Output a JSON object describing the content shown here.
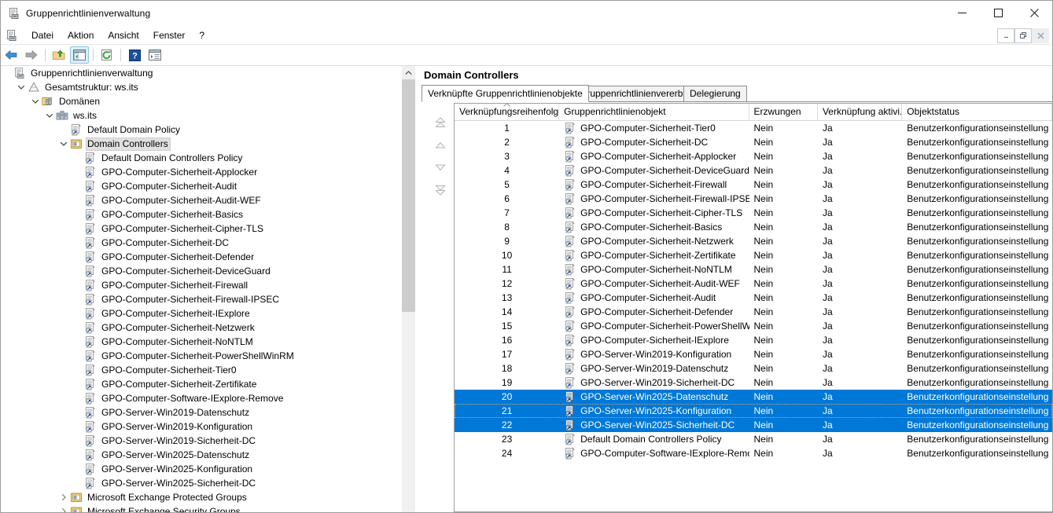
{
  "window": {
    "title": "Gruppenrichtlinienverwaltung",
    "icon": "gpmc-icon",
    "controls": {
      "minimize": "minimize-icon",
      "maximize": "maximize-icon",
      "close": "close-icon"
    }
  },
  "menubar": {
    "doc_icon": "gpmc-document-icon",
    "items": [
      "Datei",
      "Aktion",
      "Ansicht",
      "Fenster",
      "?"
    ],
    "mdi_controls": {
      "minimize": "mdi-minimize-icon",
      "restore": "mdi-restore-icon",
      "close": "mdi-close-icon"
    }
  },
  "toolbar": {
    "buttons": [
      {
        "name": "back-icon",
        "label": "Zurück"
      },
      {
        "name": "forward-icon",
        "label": "Vorwärts"
      },
      {
        "name": "up-folder-icon",
        "label": "Eine Ebene höher"
      },
      {
        "name": "show-hide-tree-icon",
        "label": "Konsolenstruktur anzeigen/ausblenden"
      },
      {
        "name": "refresh-icon",
        "label": "Aktualisieren"
      },
      {
        "name": "help-icon",
        "label": "Hilfe"
      },
      {
        "name": "export-list-icon",
        "label": "Liste exportieren"
      }
    ]
  },
  "tree": {
    "scrollbar": {
      "up_arrow": "chevron-up-icon"
    },
    "items": [
      {
        "label": "Gruppenrichtlinienverwaltung",
        "indent": 0,
        "twisty": "",
        "icon": "gpmc-root-icon",
        "selected": false
      },
      {
        "label": "Gesamtstruktur: ws.its",
        "indent": 1,
        "twisty": "expanded",
        "icon": "forest-icon",
        "selected": false
      },
      {
        "label": "Domänen",
        "indent": 2,
        "twisty": "expanded",
        "icon": "domains-icon",
        "selected": false
      },
      {
        "label": "ws.its",
        "indent": 3,
        "twisty": "expanded",
        "icon": "domain-icon",
        "selected": false
      },
      {
        "label": "Default Domain Policy",
        "indent": 4,
        "twisty": "",
        "icon": "gpo-icon",
        "selected": false
      },
      {
        "label": "Domain Controllers",
        "indent": 4,
        "twisty": "expanded",
        "icon": "ou-icon",
        "selected": true
      },
      {
        "label": "Default Domain Controllers Policy",
        "indent": 5,
        "twisty": "",
        "icon": "gpo-link-icon",
        "selected": false
      },
      {
        "label": "GPO-Computer-Sicherheit-Applocker",
        "indent": 5,
        "twisty": "",
        "icon": "gpo-link-icon",
        "selected": false
      },
      {
        "label": "GPO-Computer-Sicherheit-Audit",
        "indent": 5,
        "twisty": "",
        "icon": "gpo-link-icon",
        "selected": false
      },
      {
        "label": "GPO-Computer-Sicherheit-Audit-WEF",
        "indent": 5,
        "twisty": "",
        "icon": "gpo-link-icon",
        "selected": false
      },
      {
        "label": "GPO-Computer-Sicherheit-Basics",
        "indent": 5,
        "twisty": "",
        "icon": "gpo-link-icon",
        "selected": false
      },
      {
        "label": "GPO-Computer-Sicherheit-Cipher-TLS",
        "indent": 5,
        "twisty": "",
        "icon": "gpo-link-icon",
        "selected": false
      },
      {
        "label": "GPO-Computer-Sicherheit-DC",
        "indent": 5,
        "twisty": "",
        "icon": "gpo-link-icon",
        "selected": false
      },
      {
        "label": "GPO-Computer-Sicherheit-Defender",
        "indent": 5,
        "twisty": "",
        "icon": "gpo-link-icon",
        "selected": false
      },
      {
        "label": "GPO-Computer-Sicherheit-DeviceGuard",
        "indent": 5,
        "twisty": "",
        "icon": "gpo-link-icon",
        "selected": false
      },
      {
        "label": "GPO-Computer-Sicherheit-Firewall",
        "indent": 5,
        "twisty": "",
        "icon": "gpo-link-icon",
        "selected": false
      },
      {
        "label": "GPO-Computer-Sicherheit-Firewall-IPSEC",
        "indent": 5,
        "twisty": "",
        "icon": "gpo-link-icon",
        "selected": false
      },
      {
        "label": "GPO-Computer-Sicherheit-IExplore",
        "indent": 5,
        "twisty": "",
        "icon": "gpo-link-icon",
        "selected": false
      },
      {
        "label": "GPO-Computer-Sicherheit-Netzwerk",
        "indent": 5,
        "twisty": "",
        "icon": "gpo-link-icon",
        "selected": false
      },
      {
        "label": "GPO-Computer-Sicherheit-NoNTLM",
        "indent": 5,
        "twisty": "",
        "icon": "gpo-link-icon",
        "selected": false
      },
      {
        "label": "GPO-Computer-Sicherheit-PowerShellWinRM",
        "indent": 5,
        "twisty": "",
        "icon": "gpo-link-icon",
        "selected": false
      },
      {
        "label": "GPO-Computer-Sicherheit-Tier0",
        "indent": 5,
        "twisty": "",
        "icon": "gpo-link-icon",
        "selected": false
      },
      {
        "label": "GPO-Computer-Sicherheit-Zertifikate",
        "indent": 5,
        "twisty": "",
        "icon": "gpo-link-icon",
        "selected": false
      },
      {
        "label": "GPO-Computer-Software-IExplore-Remove",
        "indent": 5,
        "twisty": "",
        "icon": "gpo-link-icon",
        "selected": false
      },
      {
        "label": "GPO-Server-Win2019-Datenschutz",
        "indent": 5,
        "twisty": "",
        "icon": "gpo-link-icon",
        "selected": false
      },
      {
        "label": "GPO-Server-Win2019-Konfiguration",
        "indent": 5,
        "twisty": "",
        "icon": "gpo-link-icon",
        "selected": false
      },
      {
        "label": "GPO-Server-Win2019-Sicherheit-DC",
        "indent": 5,
        "twisty": "",
        "icon": "gpo-link-icon",
        "selected": false
      },
      {
        "label": "GPO-Server-Win2025-Datenschutz",
        "indent": 5,
        "twisty": "",
        "icon": "gpo-link-icon",
        "selected": false
      },
      {
        "label": "GPO-Server-Win2025-Konfiguration",
        "indent": 5,
        "twisty": "",
        "icon": "gpo-link-icon",
        "selected": false
      },
      {
        "label": "GPO-Server-Win2025-Sicherheit-DC",
        "indent": 5,
        "twisty": "",
        "icon": "gpo-link-icon",
        "selected": false
      },
      {
        "label": "Microsoft Exchange Protected Groups",
        "indent": 4,
        "twisty": "collapsed",
        "icon": "ou-icon",
        "selected": false
      },
      {
        "label": "Microsoft Exchange Security Groups",
        "indent": 4,
        "twisty": "collapsed",
        "icon": "ou-icon",
        "selected": false
      }
    ]
  },
  "detail": {
    "title": "Domain Controllers",
    "tabs": [
      {
        "label": "Verknüpfte Gruppenrichtlinienobjekte",
        "active": true
      },
      {
        "label": "Gruppenrichtlinienvererbung",
        "active": false
      },
      {
        "label": "Delegierung",
        "active": false
      }
    ],
    "order_buttons": [
      {
        "name": "move-to-top-button",
        "icon": "double-up-arrow-icon"
      },
      {
        "name": "move-up-button",
        "icon": "up-arrow-icon"
      },
      {
        "name": "move-down-button",
        "icon": "down-arrow-icon"
      },
      {
        "name": "move-to-bottom-button",
        "icon": "double-down-arrow-icon"
      }
    ],
    "list": {
      "sort_column": 0,
      "sort_direction": "ascending",
      "columns": [
        "Verknüpfungsreihenfolge",
        "Gruppenrichtlinienobjekt",
        "Erzwungen",
        "Verknüpfung aktivi...",
        "Objektstatus"
      ],
      "rows": [
        {
          "order": "1",
          "gpo": "GPO-Computer-Sicherheit-Tier0",
          "enforced": "Nein",
          "link_enabled": "Ja",
          "status": "Benutzerkonfigurationseinstellung",
          "selected": false,
          "focused": false
        },
        {
          "order": "2",
          "gpo": "GPO-Computer-Sicherheit-DC",
          "enforced": "Nein",
          "link_enabled": "Ja",
          "status": "Benutzerkonfigurationseinstellung",
          "selected": false,
          "focused": false
        },
        {
          "order": "3",
          "gpo": "GPO-Computer-Sicherheit-Applocker",
          "enforced": "Nein",
          "link_enabled": "Ja",
          "status": "Benutzerkonfigurationseinstellung",
          "selected": false,
          "focused": false
        },
        {
          "order": "4",
          "gpo": "GPO-Computer-Sicherheit-DeviceGuard",
          "enforced": "Nein",
          "link_enabled": "Ja",
          "status": "Benutzerkonfigurationseinstellung",
          "selected": false,
          "focused": false
        },
        {
          "order": "5",
          "gpo": "GPO-Computer-Sicherheit-Firewall",
          "enforced": "Nein",
          "link_enabled": "Ja",
          "status": "Benutzerkonfigurationseinstellung",
          "selected": false,
          "focused": false
        },
        {
          "order": "6",
          "gpo": "GPO-Computer-Sicherheit-Firewall-IPSEC",
          "enforced": "Nein",
          "link_enabled": "Ja",
          "status": "Benutzerkonfigurationseinstellung",
          "selected": false,
          "focused": false
        },
        {
          "order": "7",
          "gpo": "GPO-Computer-Sicherheit-Cipher-TLS",
          "enforced": "Nein",
          "link_enabled": "Ja",
          "status": "Benutzerkonfigurationseinstellung",
          "selected": false,
          "focused": false
        },
        {
          "order": "8",
          "gpo": "GPO-Computer-Sicherheit-Basics",
          "enforced": "Nein",
          "link_enabled": "Ja",
          "status": "Benutzerkonfigurationseinstellung",
          "selected": false,
          "focused": false
        },
        {
          "order": "9",
          "gpo": "GPO-Computer-Sicherheit-Netzwerk",
          "enforced": "Nein",
          "link_enabled": "Ja",
          "status": "Benutzerkonfigurationseinstellung",
          "selected": false,
          "focused": false
        },
        {
          "order": "10",
          "gpo": "GPO-Computer-Sicherheit-Zertifikate",
          "enforced": "Nein",
          "link_enabled": "Ja",
          "status": "Benutzerkonfigurationseinstellung",
          "selected": false,
          "focused": false
        },
        {
          "order": "11",
          "gpo": "GPO-Computer-Sicherheit-NoNTLM",
          "enforced": "Nein",
          "link_enabled": "Ja",
          "status": "Benutzerkonfigurationseinstellung",
          "selected": false,
          "focused": false
        },
        {
          "order": "12",
          "gpo": "GPO-Computer-Sicherheit-Audit-WEF",
          "enforced": "Nein",
          "link_enabled": "Ja",
          "status": "Benutzerkonfigurationseinstellung",
          "selected": false,
          "focused": false
        },
        {
          "order": "13",
          "gpo": "GPO-Computer-Sicherheit-Audit",
          "enforced": "Nein",
          "link_enabled": "Ja",
          "status": "Benutzerkonfigurationseinstellung",
          "selected": false,
          "focused": false
        },
        {
          "order": "14",
          "gpo": "GPO-Computer-Sicherheit-Defender",
          "enforced": "Nein",
          "link_enabled": "Ja",
          "status": "Benutzerkonfigurationseinstellung",
          "selected": false,
          "focused": false
        },
        {
          "order": "15",
          "gpo": "GPO-Computer-Sicherheit-PowerShellWinRM",
          "enforced": "Nein",
          "link_enabled": "Ja",
          "status": "Benutzerkonfigurationseinstellung",
          "selected": false,
          "focused": false
        },
        {
          "order": "16",
          "gpo": "GPO-Computer-Sicherheit-IExplore",
          "enforced": "Nein",
          "link_enabled": "Ja",
          "status": "Benutzerkonfigurationseinstellung",
          "selected": false,
          "focused": false
        },
        {
          "order": "17",
          "gpo": "GPO-Server-Win2019-Konfiguration",
          "enforced": "Nein",
          "link_enabled": "Ja",
          "status": "Benutzerkonfigurationseinstellung",
          "selected": false,
          "focused": false
        },
        {
          "order": "18",
          "gpo": "GPO-Server-Win2019-Datenschutz",
          "enforced": "Nein",
          "link_enabled": "Ja",
          "status": "Benutzerkonfigurationseinstellung",
          "selected": false,
          "focused": false
        },
        {
          "order": "19",
          "gpo": "GPO-Server-Win2019-Sicherheit-DC",
          "enforced": "Nein",
          "link_enabled": "Ja",
          "status": "Benutzerkonfigurationseinstellung",
          "selected": false,
          "focused": false
        },
        {
          "order": "20",
          "gpo": "GPO-Server-Win2025-Datenschutz",
          "enforced": "Nein",
          "link_enabled": "Ja",
          "status": "Benutzerkonfigurationseinstellung",
          "selected": true,
          "focused": false
        },
        {
          "order": "21",
          "gpo": "GPO-Server-Win2025-Konfiguration",
          "enforced": "Nein",
          "link_enabled": "Ja",
          "status": "Benutzerkonfigurationseinstellung",
          "selected": true,
          "focused": true
        },
        {
          "order": "22",
          "gpo": "GPO-Server-Win2025-Sicherheit-DC",
          "enforced": "Nein",
          "link_enabled": "Ja",
          "status": "Benutzerkonfigurationseinstellung",
          "selected": true,
          "focused": false
        },
        {
          "order": "23",
          "gpo": "Default Domain Controllers Policy",
          "enforced": "Nein",
          "link_enabled": "Ja",
          "status": "Benutzerkonfigurationseinstellung",
          "selected": false,
          "focused": false
        },
        {
          "order": "24",
          "gpo": "GPO-Computer-Software-IExplore-Remove",
          "enforced": "Nein",
          "link_enabled": "Ja",
          "status": "Benutzerkonfigurationseinstellung",
          "selected": false,
          "focused": false
        }
      ]
    }
  },
  "colors": {
    "selection": "#0078d7",
    "selection_text": "#ffffff",
    "tree_selection": "#e0e0e0",
    "window_bg": "#ffffff",
    "border": "#a0a0a0"
  }
}
